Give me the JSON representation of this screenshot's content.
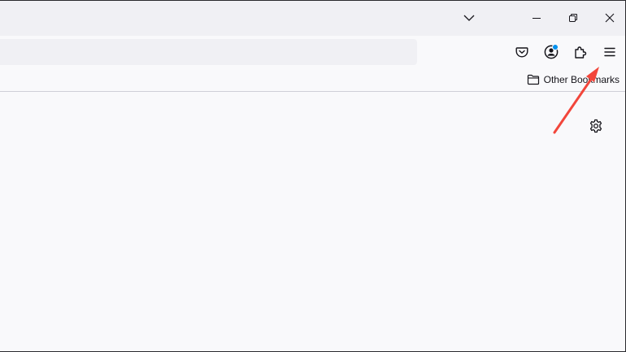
{
  "titlebar": {
    "controls": [
      {
        "name": "list-all-tabs-button",
        "icon": "chevron-down-icon"
      },
      {
        "name": "minimize-button",
        "icon": "minimize-icon"
      },
      {
        "name": "restore-button",
        "icon": "restore-icon"
      },
      {
        "name": "close-button",
        "icon": "close-icon"
      }
    ]
  },
  "toolbar": {
    "buttons": [
      {
        "name": "pocket-button",
        "icon": "pocket-icon"
      },
      {
        "name": "account-button",
        "icon": "account-icon",
        "badge": true
      },
      {
        "name": "extensions-button",
        "icon": "puzzle-icon"
      },
      {
        "name": "menu-button",
        "icon": "hamburger-menu-icon"
      }
    ]
  },
  "bookmarks": {
    "other_label": "Other Bookmarks",
    "icon": "folder-icon"
  },
  "newtab": {
    "settings_icon": "gear-icon"
  },
  "annotation": {
    "arrow_color": "#f2463b",
    "points_to": "menu-button"
  },
  "colors": {
    "titlebar_bg": "#f0f0f4",
    "toolbar_bg": "#f9f9fb",
    "urlbar_bg": "#f0f0f4",
    "badge": "#0090ed"
  }
}
